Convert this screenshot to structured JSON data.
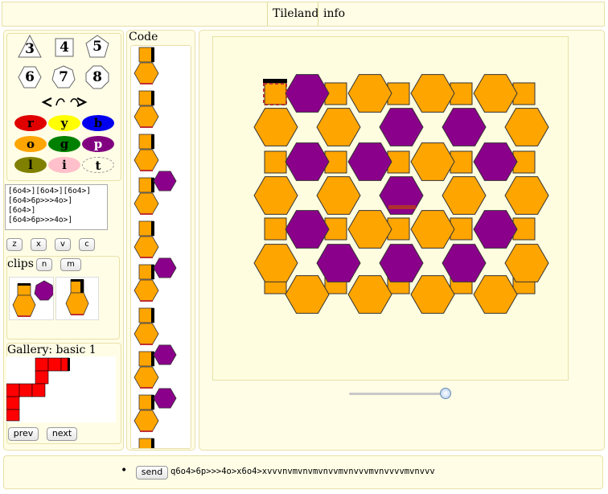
{
  "header": {
    "title_label": "Tileland",
    "info_label": "info"
  },
  "shapes": [
    {
      "label": "3",
      "icon": "triangle-icon"
    },
    {
      "label": "4",
      "icon": "square-icon"
    },
    {
      "label": "5",
      "icon": "pentagon-icon"
    },
    {
      "label": "6",
      "icon": "hexagon-icon"
    },
    {
      "label": "7",
      "icon": "heptagon-icon"
    },
    {
      "label": "8",
      "icon": "octagon-icon"
    }
  ],
  "rotate": {
    "icon": "rotate-arrows-icon",
    "glyph": "< ↶↷ >"
  },
  "colors": [
    {
      "label": "r",
      "fill": "#e00000",
      "text": "#000000"
    },
    {
      "label": "y",
      "fill": "#ffff00",
      "text": "#000000"
    },
    {
      "label": "b",
      "fill": "#0000ee",
      "text": "#000000"
    },
    {
      "label": "o",
      "fill": "#ffa500",
      "text": "#000000"
    },
    {
      "label": "g",
      "fill": "#008000",
      "text": "#000000"
    },
    {
      "label": "p",
      "fill": "#800080",
      "text": "#ffffff"
    },
    {
      "label": "l",
      "fill": "#808000",
      "text": "#000000"
    },
    {
      "label": "i",
      "fill": "#ffc0cb",
      "text": "#000000"
    },
    {
      "label": "t",
      "fill": "transparent",
      "text": "#000000"
    }
  ],
  "editor": {
    "code_text": "[6o4>][6o4>][6o4>]\n[6o4>6p>>>4o>]\n[6o4>]\n[6o4>6p>>>4o>]"
  },
  "editor_buttons": [
    "z",
    "x",
    "v",
    "c"
  ],
  "clips": {
    "title": "clips",
    "buttons": [
      "n",
      "m"
    ]
  },
  "gallery": {
    "title": "Gallery: basic 1",
    "prev_label": "prev",
    "next_label": "next"
  },
  "code_panel": {
    "title": "Code"
  },
  "slider": {
    "value": 0.97
  },
  "command": {
    "bullet": "•",
    "send_label": "send",
    "text": "q6o4>6p>>>4o>x6o4>xvvvnvmvnvmvnvvmvnvvvmvnvvvvmvnvvv"
  },
  "palette": {
    "orange": "#ffa500",
    "purple": "#8b008b",
    "red": "#ff0000",
    "marker": "#b03030"
  }
}
